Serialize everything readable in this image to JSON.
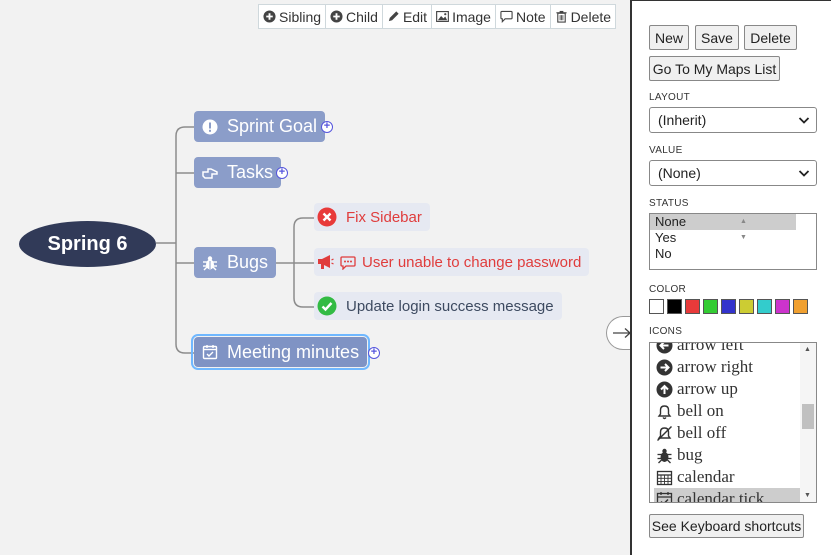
{
  "toolbar": {
    "sibling": "Sibling",
    "child": "Child",
    "edit": "Edit",
    "image": "Image",
    "note": "Note",
    "delete": "Delete"
  },
  "map": {
    "root": "Spring 6",
    "nodes": [
      {
        "label": "Sprint Goal",
        "icon": "exclamation-circle-icon"
      },
      {
        "label": "Tasks",
        "icon": "hand-point-right-icon"
      },
      {
        "label": "Bugs",
        "icon": "bug-icon"
      },
      {
        "label": "Meeting minutes",
        "icon": "calendar-check-icon"
      }
    ],
    "bugs": [
      {
        "label": "Fix Sidebar",
        "icon": "times-circle-icon",
        "color": "#e03c3c"
      },
      {
        "label": "User unable to change password",
        "icon": "megaphone-icon",
        "color": "#e03c3c"
      },
      {
        "label": "Update login success message",
        "icon": "check-circle-icon",
        "color": "#3d4a60"
      }
    ]
  },
  "panel": {
    "new": "New",
    "save": "Save",
    "delete": "Delete",
    "goto": "Go To My Maps List",
    "layout_label": "LAYOUT",
    "layout_value": "(Inherit)",
    "value_label": "VALUE",
    "value_value": "(None)",
    "status_label": "STATUS",
    "status_options": [
      "None",
      "Yes",
      "No"
    ],
    "status_selected": "None",
    "color_label": "COLOR",
    "colors": [
      "#ffffff",
      "#000000",
      "#e83a3a",
      "#33cc33",
      "#3333cc",
      "#cccc33",
      "#33cccc",
      "#cc33cc",
      "#f0a030"
    ],
    "icons_label": "ICONS",
    "icons": [
      {
        "label": "arrow left",
        "icon": "arrow-left-icon"
      },
      {
        "label": "arrow right",
        "icon": "arrow-right-icon"
      },
      {
        "label": "arrow up",
        "icon": "arrow-up-icon"
      },
      {
        "label": "bell on",
        "icon": "bell-icon"
      },
      {
        "label": "bell off",
        "icon": "bell-off-icon"
      },
      {
        "label": "bug",
        "icon": "bug-icon"
      },
      {
        "label": "calendar",
        "icon": "calendar-icon"
      },
      {
        "label": "calendar tick",
        "icon": "calendar-tick-icon"
      }
    ],
    "icons_selected": "calendar tick",
    "shortcuts": "See Keyboard shortcuts"
  },
  "colors": {
    "root_bg": "#313a58",
    "node_bg": "#8b9dc9",
    "leaf_bg": "#e6e9f2",
    "selected_outline": "#70b8ff"
  }
}
